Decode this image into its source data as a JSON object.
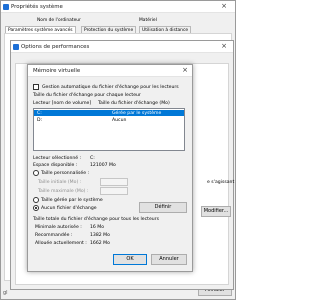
{
  "system_properties": {
    "title": "Propriétés système",
    "tabs": [
      "Nom de l'ordinateur",
      "Matériel",
      "Paramètres système avancés",
      "Protection du système",
      "Utilisation à distance"
    ],
    "cancel": "Annuler",
    "taskbar": "gl"
  },
  "performance_options": {
    "title": "Options de performances",
    "side_texts": [
      "e s'agissant",
      "Modifier..."
    ]
  },
  "virtual_memory": {
    "title": "Mémoire virtuelle",
    "auto_manage_label": "Gestion automatique du fichier d'échange pour les lecteurs",
    "per_drive_caption": "Taille du fichier d'échange pour chaque lecteur",
    "list_headers": [
      "Lecteur [nom de volume]",
      "Taille du fichier d'échange (Mo)"
    ],
    "drives": [
      {
        "drive": "C:",
        "size": "Gérée par le système",
        "selected": true
      },
      {
        "drive": "D:",
        "size": "Aucun",
        "selected": false
      }
    ],
    "selected_drive_label": "Lecteur sélectionné :",
    "selected_drive_value": "C:",
    "free_space_label": "Espace disponible :",
    "free_space_value": "121007 Mo",
    "custom_size_label": "Taille personnalisée :",
    "initial_size_label": "Taille initiale (Mo) :",
    "max_size_label": "Taille maximale (Mo) :",
    "system_managed_label": "Taille gérée par le système",
    "no_paging_label": "Aucun fichier d'échange",
    "define_button": "Définir",
    "total_caption": "Taille totale du fichier d'échange pour tous les lecteurs",
    "min_allowed_label": "Minimale autorisée :",
    "min_allowed_value": "16 Mo",
    "recommended_label": "Recommandée :",
    "recommended_value": "1382 Mo",
    "current_label": "Allouée actuellement :",
    "current_value": "1662 Mo",
    "ok_button": "OK",
    "cancel_button": "Annuler"
  }
}
